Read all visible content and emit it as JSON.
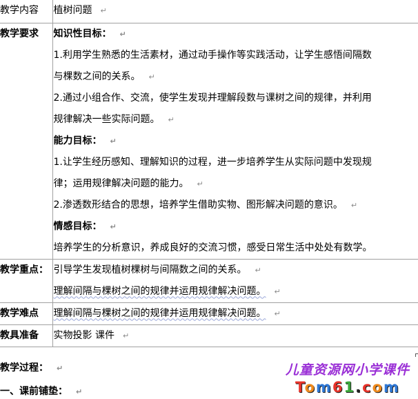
{
  "table": {
    "content_label": "教学内容",
    "content_value": "植树问题",
    "requirements_label": "教学要求",
    "knowledge_heading": "知识性目标：",
    "knowledge_1_line1": "1.利用学生熟悉的生活素材，通过动手操作等实践活动，让学生感悟间隔数",
    "knowledge_1_line2": "与棵数之间的关系。",
    "knowledge_2_line1": "2.通过小组合作、交流，使学生发现并理解段数与课树之间的规律，并利用",
    "knowledge_2_line2": "规律解决一些实际问题。",
    "ability_heading": "能力目标：",
    "ability_1_line1": "1.让学生经历感知、理解知识的过程，进一步培养学生从实际问题中发现规",
    "ability_1_line2": "律；运用规律解决问题的能力。",
    "ability_2_line1": "2.渗透数形结合的思想，培养学生借助实物、图形解决问题的意识。",
    "emotion_heading": "情感目标：",
    "emotion_line1": "培养学生的分析意识，养成良好的交流习惯，感受日常生活中处处有数学。",
    "key_label": "教学重点：",
    "key_line1": "引导学生发现植树棵树与间隔数之间的关系。",
    "key_line2": "理解间隔与棵树之间的规律并运用规律解决问题。",
    "difficulty_label": "教学难点",
    "difficulty_line1": "理解间隔与棵树之间的规律并运用规律解决问题。",
    "prep_label": "教具准备",
    "prep_value": "实物投影  课件"
  },
  "process_heading": "教学过程：",
  "section_1_heading": "一、课前铺垫：",
  "paragraph_mark": "↵",
  "watermark": {
    "line1": "儿童资源网小学课件",
    "line2_parts": [
      "T",
      "o",
      "m",
      "6",
      "1",
      ".",
      "c",
      "o",
      "m"
    ],
    "line2_colors": [
      "#e8332a",
      "#f08a1c",
      "#2f78d6",
      "#e8332a",
      "#3aa63a",
      "#222222",
      "#e8332a",
      "#f08a1c",
      "#2f78d6"
    ],
    "line1_color": "#9a2fd6"
  }
}
